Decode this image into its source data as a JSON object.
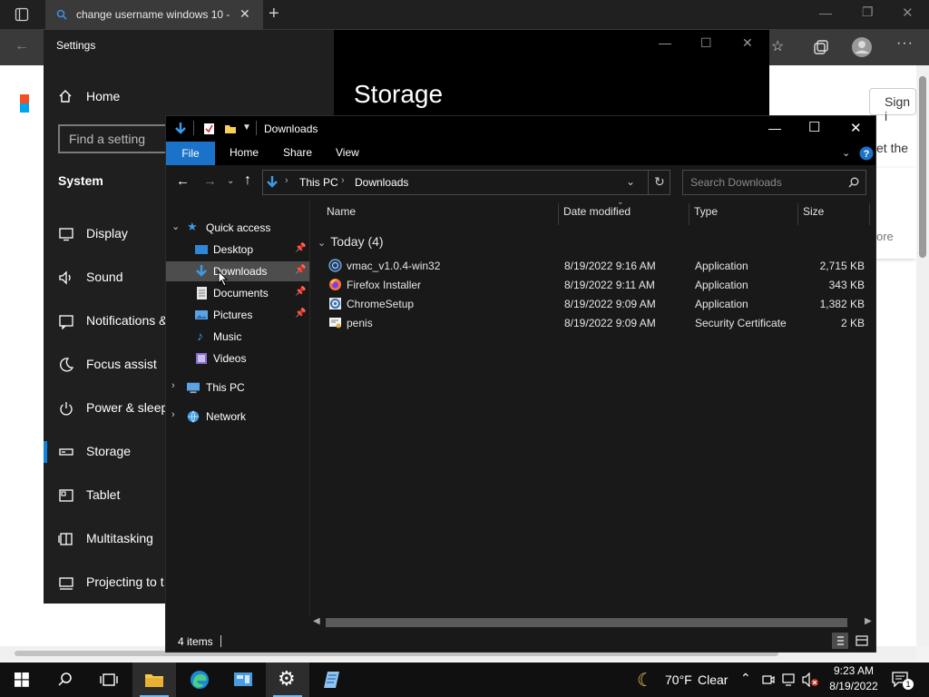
{
  "browser": {
    "tab_title": "change username windows 10 -",
    "sign_in": "Sign i",
    "side_text_1": "et the",
    "side_text_2": "ore"
  },
  "settings": {
    "window_title": "Settings",
    "home": "Home",
    "search_placeholder": "Find a setting",
    "section": "System",
    "heading": "Storage",
    "nav": [
      {
        "label": "Display",
        "icon": "display-icon"
      },
      {
        "label": "Sound",
        "icon": "speaker-icon"
      },
      {
        "label": "Notifications &",
        "icon": "notifications-icon"
      },
      {
        "label": "Focus assist",
        "icon": "moon-icon"
      },
      {
        "label": "Power & sleep",
        "icon": "power-icon"
      },
      {
        "label": "Storage",
        "icon": "storage-icon",
        "active": true
      },
      {
        "label": "Tablet",
        "icon": "tablet-icon"
      },
      {
        "label": "Multitasking",
        "icon": "multitasking-icon"
      },
      {
        "label": "Projecting to t",
        "icon": "projecting-icon"
      }
    ]
  },
  "explorer": {
    "window_title": "Downloads",
    "ribbon": {
      "file": "File",
      "home": "Home",
      "share": "Share",
      "view": "View"
    },
    "breadcrumb": [
      "This PC",
      "Downloads"
    ],
    "search_placeholder": "Search Downloads",
    "nav_tree": {
      "quick_access": "Quick access",
      "items": [
        {
          "label": "Desktop",
          "icon": "desktop-folder-icon",
          "pinned": true
        },
        {
          "label": "Downloads",
          "icon": "downloads-folder-icon",
          "pinned": true,
          "selected": true
        },
        {
          "label": "Documents",
          "icon": "documents-folder-icon",
          "pinned": true
        },
        {
          "label": "Pictures",
          "icon": "pictures-folder-icon",
          "pinned": true
        },
        {
          "label": "Music",
          "icon": "music-folder-icon",
          "pinned": false
        },
        {
          "label": "Videos",
          "icon": "videos-folder-icon",
          "pinned": false
        }
      ],
      "this_pc": "This PC",
      "network": "Network"
    },
    "columns": {
      "name": "Name",
      "date": "Date modified",
      "type": "Type",
      "size": "Size"
    },
    "group": "Today (4)",
    "files": [
      {
        "name": "vmac_v1.0.4-win32",
        "date": "8/19/2022 9:16 AM",
        "type": "Application",
        "size": "2,715 KB",
        "icon": "vmac-app-icon"
      },
      {
        "name": "Firefox Installer",
        "date": "8/19/2022 9:11 AM",
        "type": "Application",
        "size": "343 KB",
        "icon": "firefox-icon"
      },
      {
        "name": "ChromeSetup",
        "date": "8/19/2022 9:09 AM",
        "type": "Application",
        "size": "1,382 KB",
        "icon": "chrome-setup-icon"
      },
      {
        "name": "penis",
        "date": "8/19/2022 9:09 AM",
        "type": "Security Certificate",
        "size": "2 KB",
        "icon": "certificate-icon"
      }
    ],
    "status": "4 items"
  },
  "taskbar": {
    "weather_temp": "70°F",
    "weather_cond": "Clear",
    "time": "9:23 AM",
    "date": "8/19/2022",
    "notification_count": "1"
  },
  "colors": {
    "accent": "#1a73c9",
    "taskbar": "#101010",
    "explorer_bg": "#191919"
  }
}
